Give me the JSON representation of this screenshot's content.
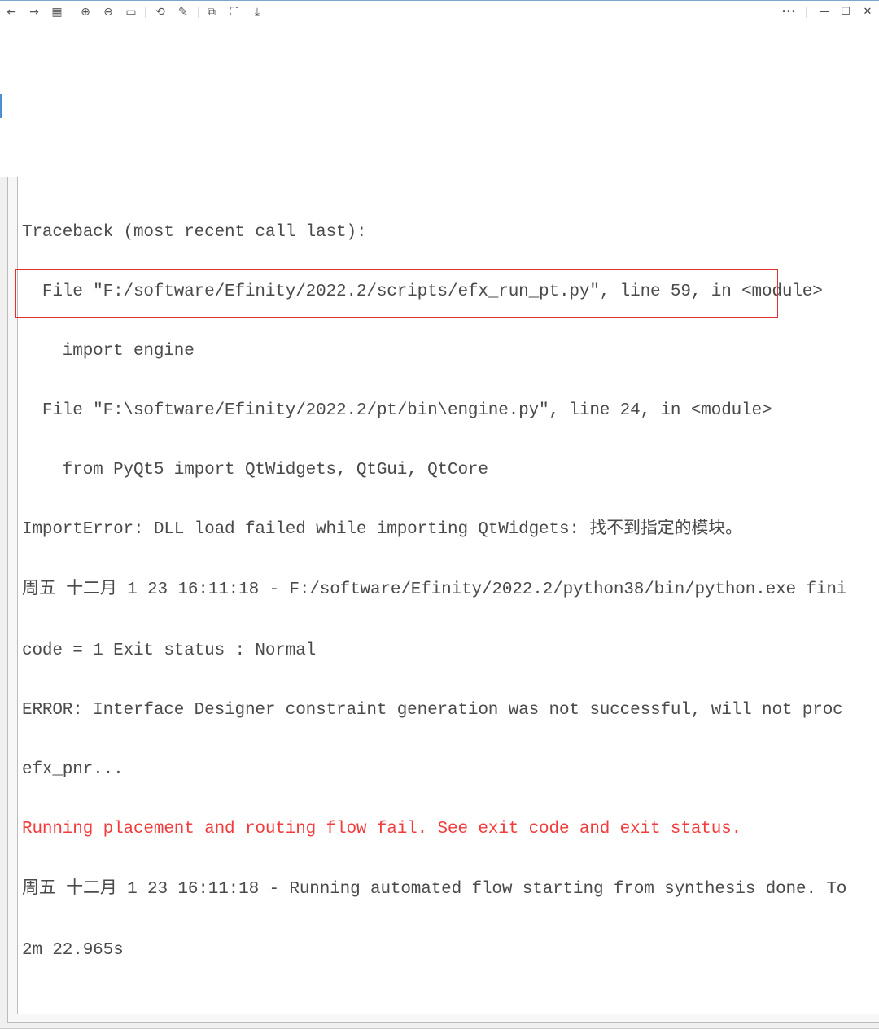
{
  "toolbar": {
    "buttons": [
      {
        "name": "back",
        "glyph": "←"
      },
      {
        "name": "forward",
        "glyph": "→"
      },
      {
        "name": "grid",
        "glyph": "▦"
      },
      {
        "name": "zoom-in",
        "glyph": "⊕"
      },
      {
        "name": "zoom-out",
        "glyph": "⊖"
      },
      {
        "name": "actual-size",
        "glyph": "▭"
      },
      {
        "name": "rotate",
        "glyph": "⟲"
      },
      {
        "name": "edit",
        "glyph": "✎"
      },
      {
        "name": "translate",
        "glyph": "⧉"
      },
      {
        "name": "ocr",
        "glyph": "⛶"
      },
      {
        "name": "save",
        "glyph": "⤓"
      }
    ],
    "more_glyph": "•••",
    "minimize_glyph": "—",
    "maximize_glyph": "☐",
    "close_glyph": "✕"
  },
  "console": {
    "lines": [
      "Traceback (most recent call last):",
      "  File \"F:/software/Efinity/2022.2/scripts/efx_run_pt.py\", line 59, in <module>",
      "    import engine",
      "  File \"F:\\software/Efinity/2022.2/pt/bin\\engine.py\", line 24, in <module>",
      "    from PyQt5 import QtWidgets, QtGui, QtCore",
      "ImportError: DLL load failed while importing QtWidgets: 找不到指定的模块。",
      "周五 十二月 1 23 16:11:18 - F:/software/Efinity/2022.2/python38/bin/python.exe fini",
      "code = 1 Exit status : Normal",
      "ERROR: Interface Designer constraint generation was not successful, will not proc",
      "efx_pnr...",
      "Running placement and routing flow fail. See exit code and exit status.",
      "周五 十二月 1 23 16:11:18 - Running automated flow starting from synthesis done. To",
      "2m 22.965s"
    ],
    "error_color": "#f03c3c",
    "highlight_color": "#e03030"
  }
}
